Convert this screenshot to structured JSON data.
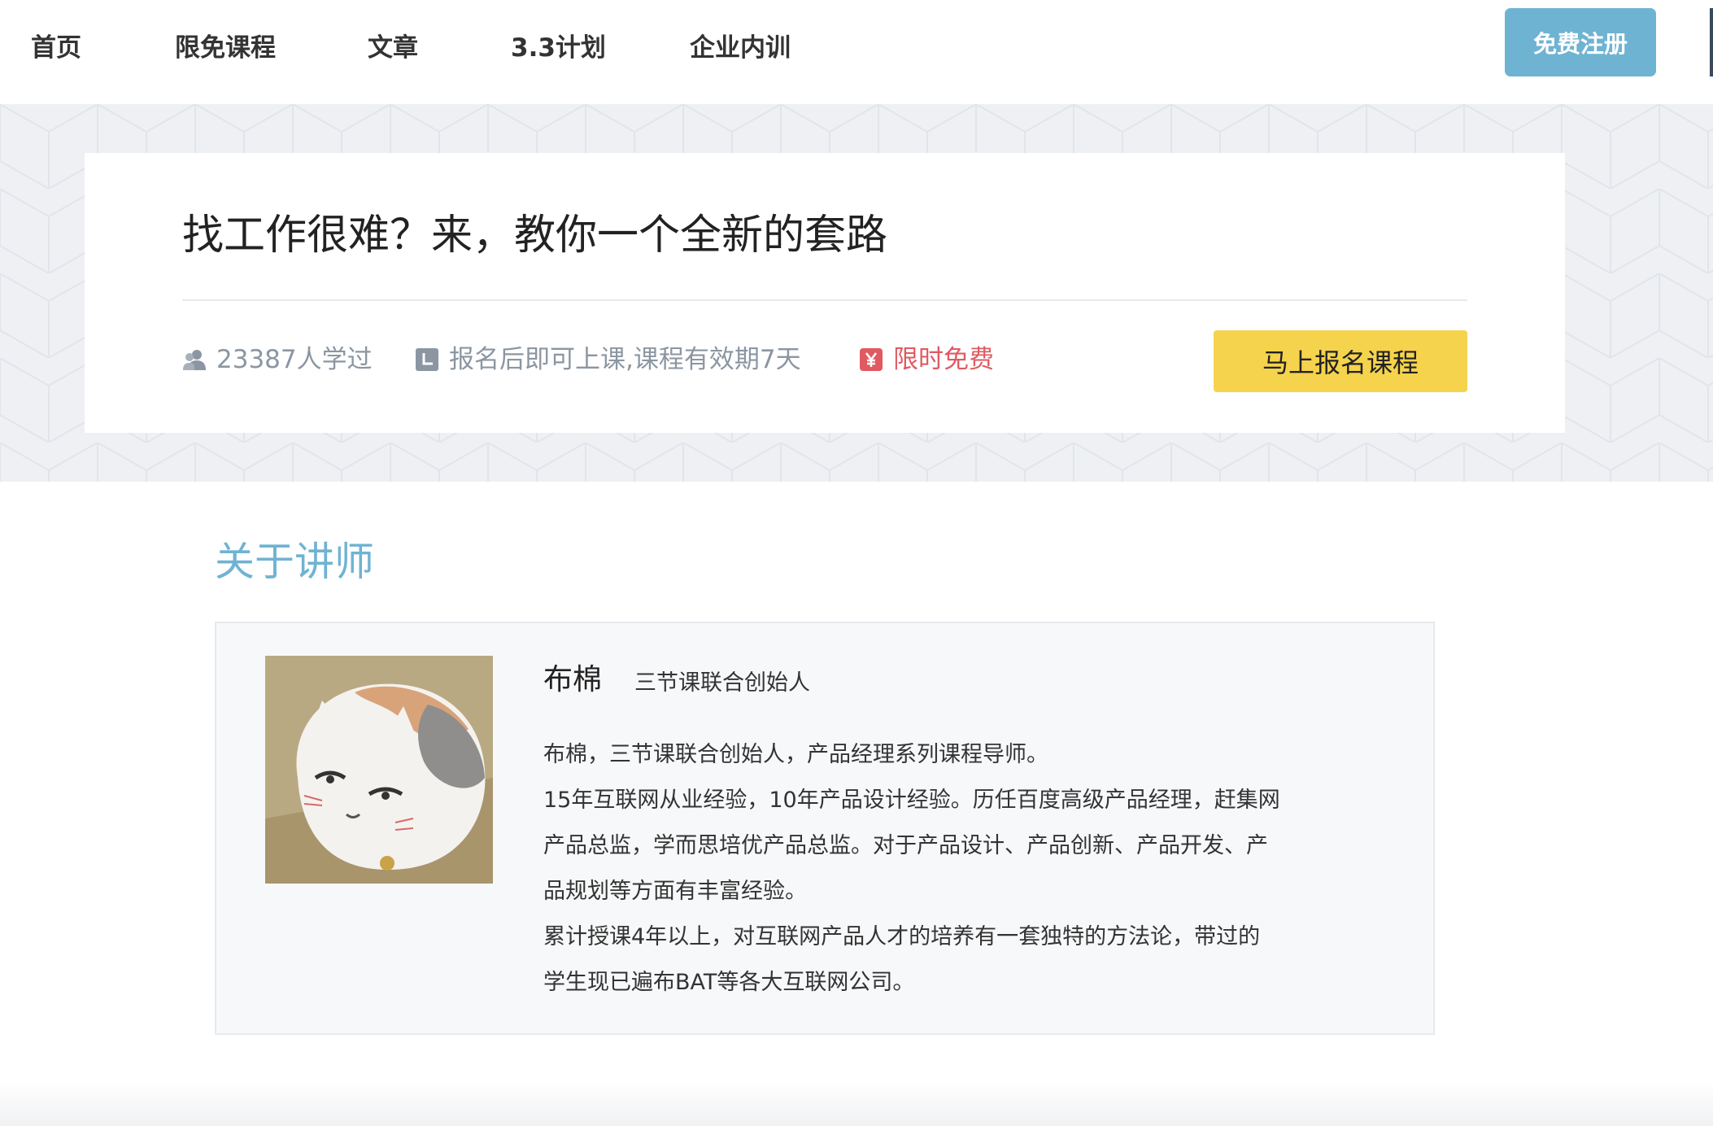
{
  "nav": {
    "items": [
      {
        "label": "首页"
      },
      {
        "label": "限免课程"
      },
      {
        "label": "文章"
      },
      {
        "label": "3.3计划"
      },
      {
        "label": "企业内训"
      }
    ],
    "register_label": "免费注册"
  },
  "course": {
    "title": "找工作很难？来，教你一个全新的套路",
    "learners": "23387人学过",
    "validity": "报名后即可上课,课程有效期7天",
    "price": "限时免费",
    "enroll_label": "马上报名课程"
  },
  "teacher_section": {
    "title": "关于讲师",
    "name": "布棉",
    "role": "三节课联合创始人",
    "bio_lines": [
      "布棉，三节课联合创始人，产品经理系列课程导师。",
      "15年互联网从业经验，10年产品设计经验。历任百度高级产品经理，赶集网",
      "产品总监，学而思培优产品总监。对于产品设计、产品创新、产品开发、产",
      "品规划等方面有丰富经验。",
      "累计授课4年以上，对互联网产品人才的培养有一套独特的方法论，带过的",
      "学生现已遍布BAT等各大互联网公司。"
    ]
  },
  "colors": {
    "accent_blue": "#6fb3d2",
    "enroll_yellow": "#f5d34c",
    "free_red": "#e05a62",
    "meta_gray": "#8b96a2"
  },
  "icons": {
    "learners": "users-icon",
    "validity": "clock-icon",
    "price": "yen-icon"
  }
}
